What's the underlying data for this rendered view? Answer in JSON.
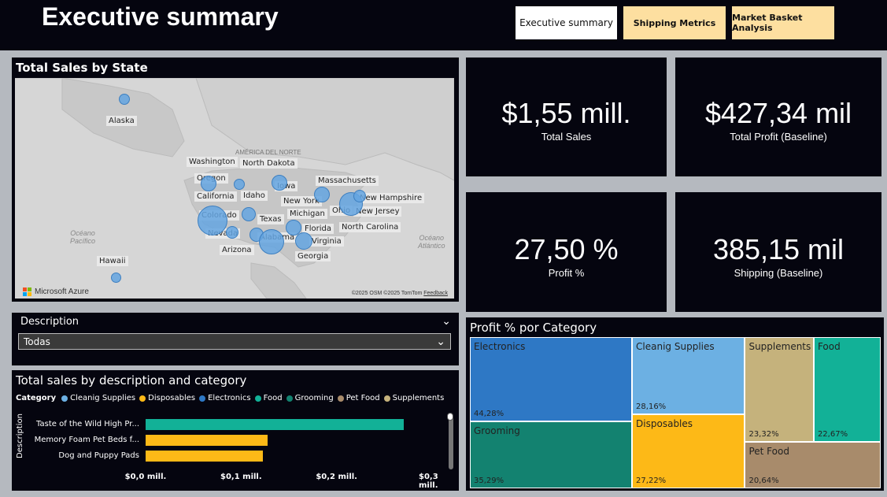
{
  "header": {
    "title": "Executive summary",
    "nav": {
      "active": "Executive summary",
      "shipping": "Shipping Metrics",
      "basket": "Market Basket Analysis"
    }
  },
  "map": {
    "title": "Total Sales by State",
    "labels": {
      "alaska": "Alaska",
      "hawaii": "Hawaii",
      "washington": "Washington",
      "north_dakota": "North Dakota",
      "oregon": "Oregon",
      "california": "California",
      "idaho": "Idaho",
      "iowa": "Iowa",
      "massachusetts": "Massachusetts",
      "new_hampshire": "New Hampshire",
      "new_york": "New York",
      "colorado": "Colorado",
      "michigan": "Michigan",
      "ohio": "Ohio",
      "new_jersey": "New Jersey",
      "texas": "Texas",
      "nevada": "Nevada",
      "alabama": "Alabama",
      "florida": "Florida",
      "north_carolina": "North Carolina",
      "virginia": "Virginia",
      "arizona": "Arizona",
      "georgia": "Georgia"
    },
    "region": "AMÉRICA DEL NORTE",
    "ocean_pacific": "Océano\nPacífico",
    "ocean_atlantic": "Océano\nAtlántico",
    "brand": "Microsoft Azure",
    "credit_osm": "©2025 OSM",
    "credit_tomtom": "©2025 TomTom",
    "credit_feedback": "Feedback",
    "colors": {
      "bubble": "#64a5e1"
    }
  },
  "kpis": {
    "sales": {
      "value": "$1,55 mill.",
      "label": "Total Sales"
    },
    "profit": {
      "value": "$427,34 mil",
      "label": "Total Profit (Baseline)"
    },
    "profit_pct": {
      "value": "27,50 %",
      "label": "Profit %"
    },
    "shipping": {
      "value": "385,15 mil",
      "label": "Shipping (Baseline)"
    }
  },
  "slicer": {
    "title": "Description",
    "selected": "Todas"
  },
  "bar_chart": {
    "title": "Total sales by description and category",
    "legend_title": "Category",
    "legend": [
      {
        "name": "Cleanig Supplies",
        "color": "#6cb0e3"
      },
      {
        "name": "Disposables",
        "color": "#fdb917"
      },
      {
        "name": "Electronics",
        "color": "#2e78c5"
      },
      {
        "name": "Food",
        "color": "#12b197"
      },
      {
        "name": "Grooming",
        "color": "#138270"
      },
      {
        "name": "Pet Food",
        "color": "#a88b6b"
      },
      {
        "name": "Supplements",
        "color": "#c5b27c"
      }
    ],
    "ylabel": "Description",
    "ticks": [
      "$0,0 mill.",
      "$0,1 mill.",
      "$0,2 mill.",
      "$0,3 mill."
    ]
  },
  "chart_data": [
    {
      "type": "bar",
      "orientation": "horizontal",
      "title": "Total sales by description and category",
      "ylabel": "Description",
      "xlim": [
        0,
        0.3
      ],
      "x_unit": "mill.",
      "categories": [
        "Taste of the Wild High Pr...",
        "Memory Foam Pet Beds f...",
        "Dog and Puppy Pads"
      ],
      "values": [
        0.27,
        0.128,
        0.123
      ],
      "category_series": [
        "Food",
        "Disposables",
        "Disposables"
      ]
    },
    {
      "type": "treemap",
      "title": "Profit % por Category",
      "items": [
        {
          "name": "Electronics",
          "label": "44,28%",
          "value": 44.28,
          "color": "#2e78c5"
        },
        {
          "name": "Grooming",
          "label": "35,29%",
          "value": 35.29,
          "color": "#138270"
        },
        {
          "name": "Cleanig Supplies",
          "label": "28,16%",
          "value": 28.16,
          "color": "#6cb0e3"
        },
        {
          "name": "Disposables",
          "label": "27,22%",
          "value": 27.22,
          "color": "#fdb917"
        },
        {
          "name": "Supplements",
          "label": "23,32%",
          "value": 23.32,
          "color": "#c5b27c"
        },
        {
          "name": "Food",
          "label": "22,67%",
          "value": 22.67,
          "color": "#12b197"
        },
        {
          "name": "Pet Food",
          "label": "20,64%",
          "value": 20.64,
          "color": "#a88b6b"
        }
      ]
    }
  ]
}
